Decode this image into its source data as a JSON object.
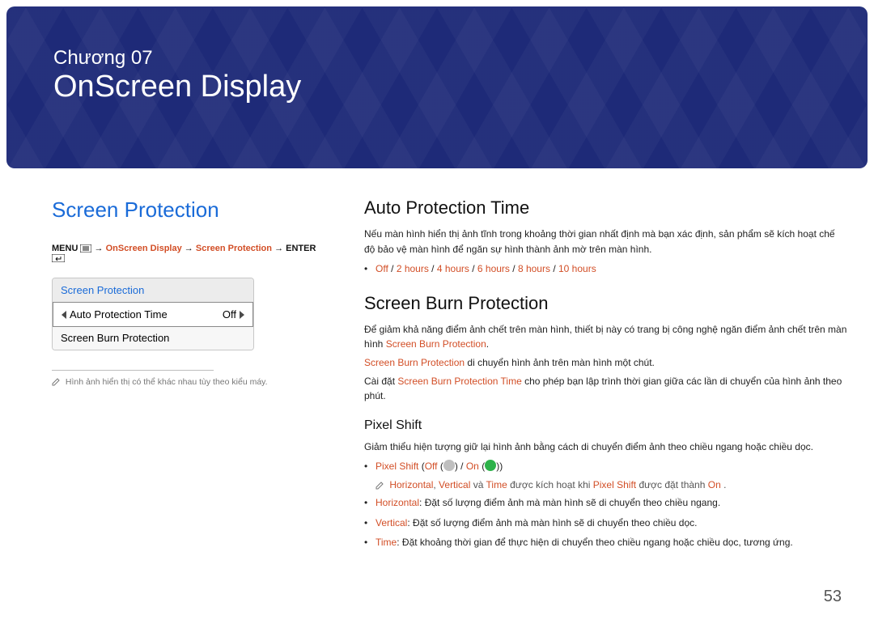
{
  "page_number": "53",
  "banner": {
    "chapter": "Chương 07",
    "title": "OnScreen Display"
  },
  "left": {
    "heading": "Screen Protection",
    "crumbs": {
      "menu": "MENU",
      "p1": "OnScreen Display",
      "p2": "Screen Protection",
      "enter": "ENTER"
    },
    "menu": {
      "header": "Screen Protection",
      "row1_label": "Auto Protection Time",
      "row1_value": "Off",
      "row2_label": "Screen Burn Protection"
    },
    "footnote": "Hình ảnh hiển thị có thể khác nhau tùy theo kiểu máy."
  },
  "right": {
    "apt": {
      "heading": "Auto Protection Time",
      "p1": "Nếu màn hình hiển thị ảnh tĩnh trong khoảng thời gian nhất định mà bạn xác định, sản phẩm sẽ kích hoạt chế độ bảo vệ màn hình để ngăn sự hình thành ảnh mờ trên màn hình.",
      "opts": {
        "o1": "Off",
        "o2": "2 hours",
        "o3": "4 hours",
        "o4": "6 hours",
        "o5": "8 hours",
        "o6": "10 hours"
      }
    },
    "sbp": {
      "heading": "Screen Burn Protection",
      "p1a": "Để giảm khả năng điểm ảnh chết trên màn hình, thiết bị này có trang bị công nghệ ngăn điểm ảnh chết trên màn hình ",
      "p1b": "Screen Burn Protection",
      "p1c": ".",
      "p2a": "Screen Burn Protection",
      "p2b": " di chuyển hình ảnh trên màn hình một chút.",
      "p3a": "Cài đặt ",
      "p3b": "Screen Burn Protection Time",
      "p3c": " cho phép bạn lập trình thời gian giữa các lần di chuyển của hình ảnh theo phút."
    },
    "ps": {
      "heading": "Pixel Shift",
      "p1": "Giảm thiểu hiện tượng giữ lại hình ảnh bằng cách di chuyển điểm ảnh theo chiều ngang hoặc chiều dọc.",
      "toggle": {
        "label": "Pixel Shift",
        "off": "Off",
        "on": "On"
      },
      "note": {
        "a": "Horizontal",
        "b": "Vertical",
        "c": " và ",
        "d": "Time",
        "e": " được kích hoạt khi ",
        "f": "Pixel Shift",
        "g": " được đặt thành ",
        "h": "On",
        "i": "."
      },
      "h": {
        "k": "Horizontal",
        "v": ": Đặt số lượng điểm ảnh mà màn hình sẽ di chuyển theo chiều ngang."
      },
      "v": {
        "k": "Vertical",
        "v": ": Đặt số lượng điểm ảnh mà màn hình sẽ di chuyển theo chiều dọc."
      },
      "t": {
        "k": "Time",
        "v": ": Đặt khoảng thời gian để thực hiện di chuyển theo chiều ngang hoặc chiều dọc, tương ứng."
      }
    }
  }
}
